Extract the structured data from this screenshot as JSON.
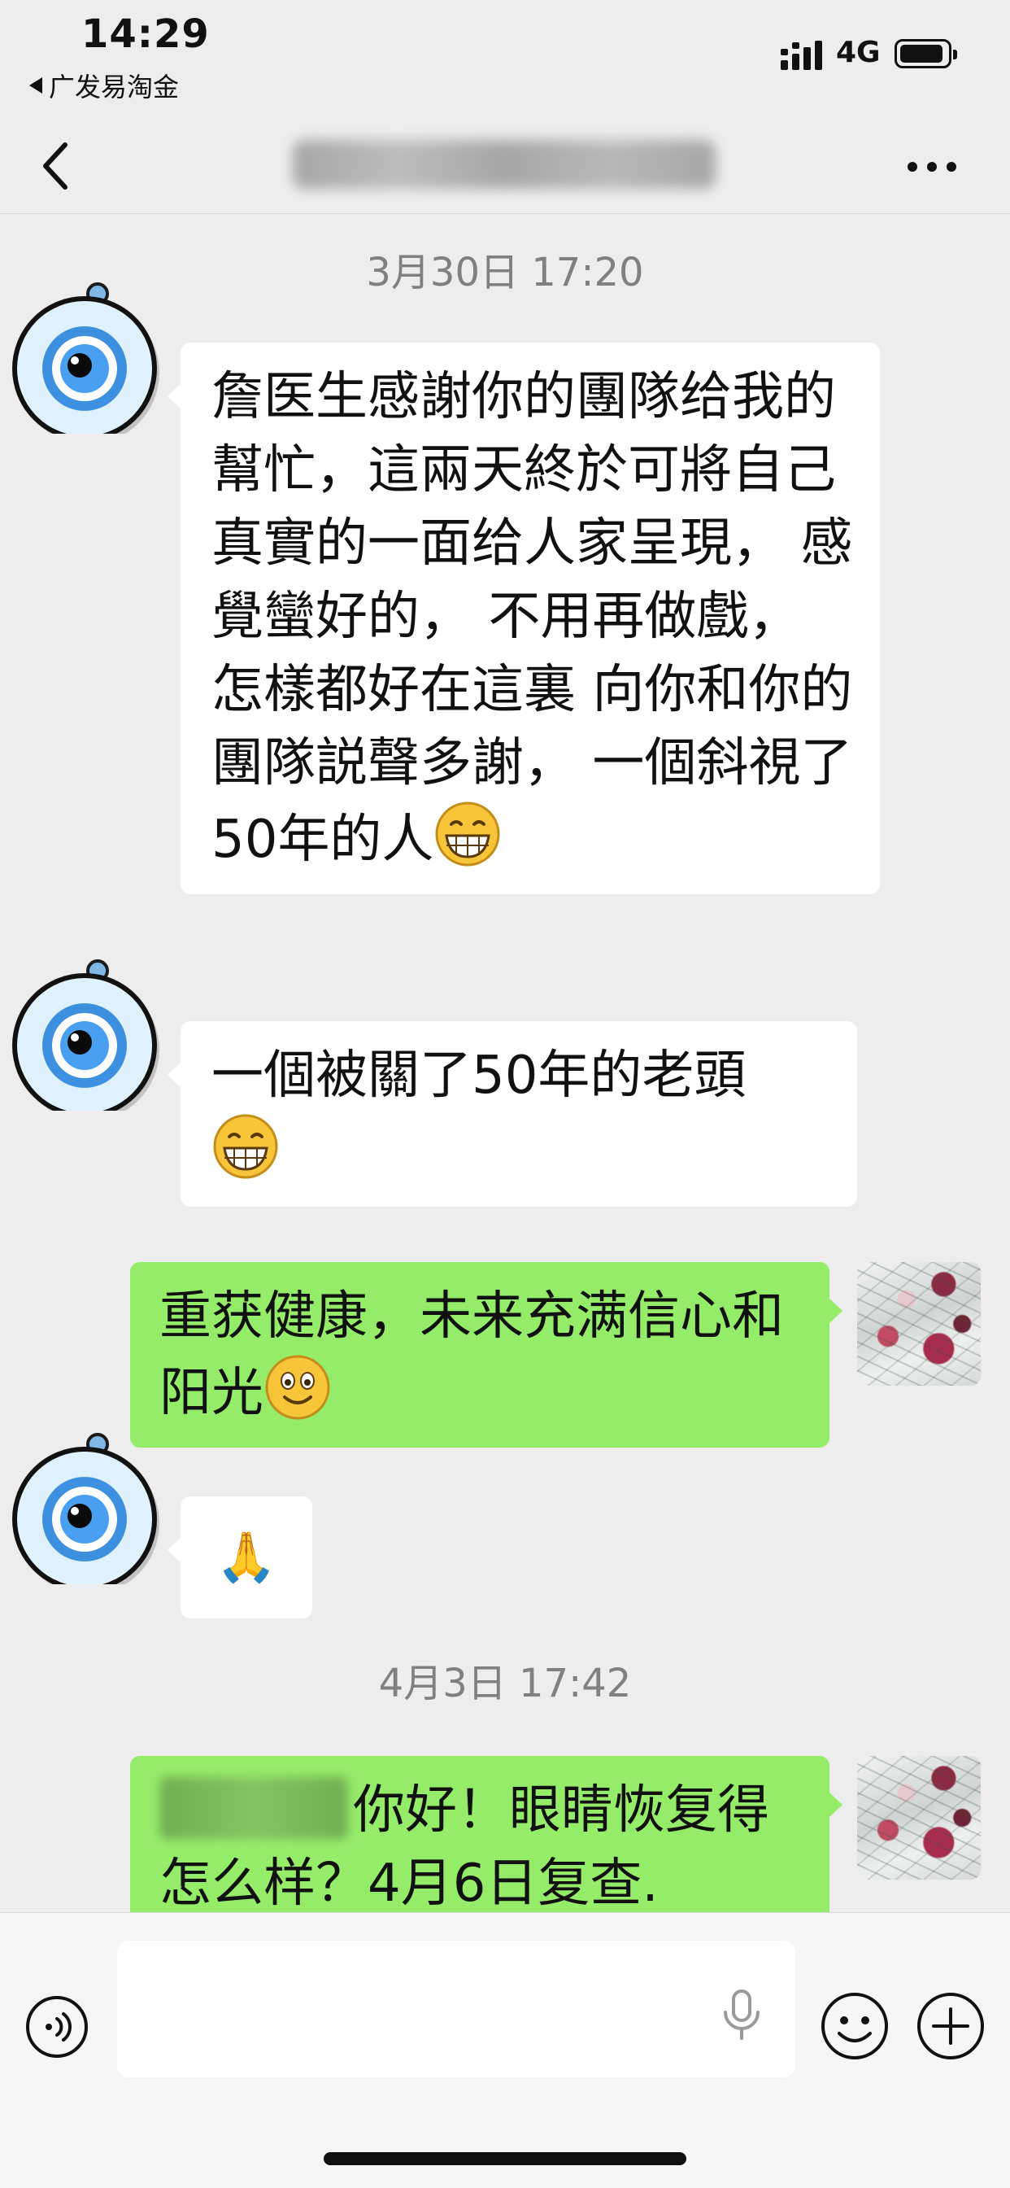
{
  "status_bar": {
    "time": "14:29",
    "back_app": "广发易淘金",
    "network": "4G"
  },
  "nav": {
    "title": ""
  },
  "messages": {
    "ts1": "3月30日 17:20",
    "m1": "詹医生感謝你的團隊给我的幫忙，這兩天終於可將自己真實的一面给人家呈現， 感覺蠻好的， 不用再做戲， 怎樣都好在這裏 向你和你的團隊説聲多謝， 一個斜視了50年的人",
    "m2": "一個被關了50年的老頭",
    "m3": "重获健康，未来充满信心和阳光",
    "m4": "🙏",
    "ts2": "4月3日 17:42",
    "m5": "你好！眼睛恢复得怎么样？4月6日复查."
  },
  "icons": {
    "contact_avatar": "eye-avatar-icon",
    "my_avatar": "flower-photo-avatar",
    "grin": "grinning-face-emoji",
    "smile": "smiling-face-emoji"
  },
  "colors": {
    "outgoing_bubble": "#95ec69",
    "incoming_bubble": "#ffffff",
    "background": "#ededed"
  }
}
